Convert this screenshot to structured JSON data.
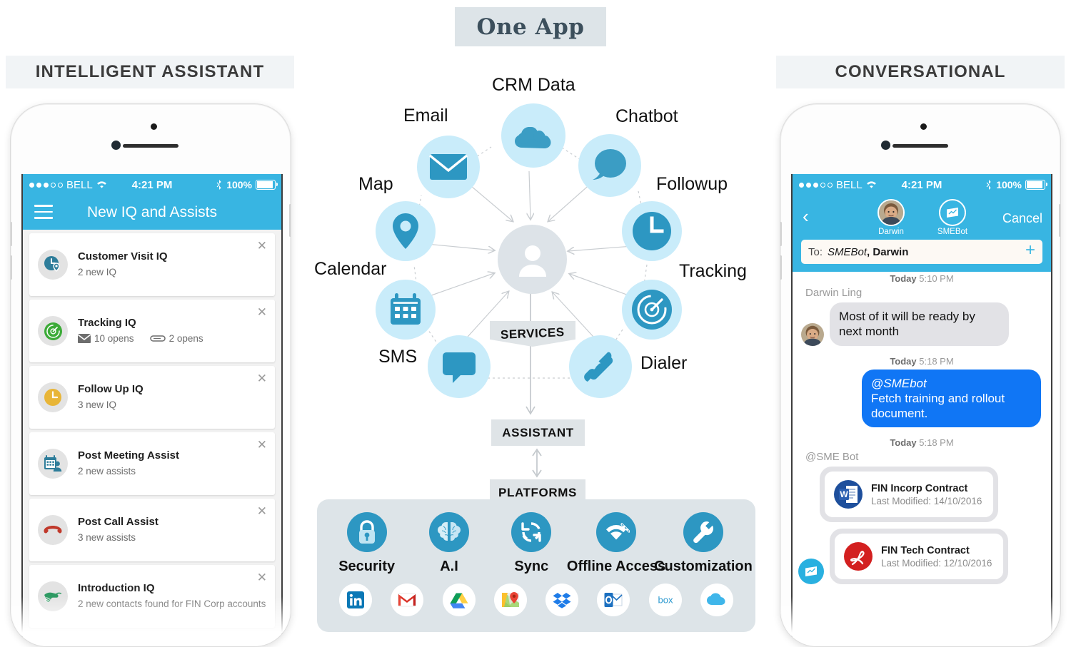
{
  "banner": {
    "title": "One App"
  },
  "columns": {
    "left_header": "INTELLIGENT ASSISTANT",
    "right_header": "CONVERSATIONAL"
  },
  "colors": {
    "ios_blue": "#38b5e2",
    "bubble_blue": "#1076f5",
    "node_fill": "#c9ecfa",
    "node_icon": "#2d97c2",
    "panel_gray": "#dde4e8",
    "banner_text": "#3c4f5c"
  },
  "left_phone": {
    "statusbar": {
      "carrier": "BELL",
      "time": "4:21 PM",
      "battery": "100%"
    },
    "nav": {
      "menu_icon": "hamburger-icon",
      "title": "New IQ and Assists"
    },
    "items": [
      {
        "title": "Customer Visit IQ",
        "subtitle": "2 new IQ",
        "icon": "clock-location-icon",
        "close": "✕"
      },
      {
        "title": "Tracking IQ",
        "meta": [
          {
            "icon": "envelope-icon",
            "text": "10 opens"
          },
          {
            "icon": "paperclip-icon",
            "text": "2 opens"
          }
        ],
        "icon": "speedometer-icon",
        "close": "✕"
      },
      {
        "title": "Follow Up IQ",
        "subtitle": "3 new IQ",
        "icon": "clock-icon",
        "close": "✕"
      },
      {
        "title": "Post Meeting Assist",
        "subtitle": "2 new assists",
        "icon": "calendar-person-icon",
        "close": "✕"
      },
      {
        "title": "Post Call Assist",
        "subtitle": "3 new assists",
        "icon": "phone-hangup-icon",
        "close": "✕"
      },
      {
        "title": "Introduction IQ",
        "subtitle": "2 new contacts found for FIN Corp accounts",
        "icon": "handshake-icon",
        "close": "✕"
      }
    ]
  },
  "right_phone": {
    "statusbar": {
      "carrier": "BELL",
      "time": "4:21 PM",
      "battery": "100%"
    },
    "nav": {
      "back": "‹",
      "cancel": "Cancel"
    },
    "participants": [
      {
        "name": "Darwin",
        "icon": "avatar-photo"
      },
      {
        "name": "SMEBot",
        "icon": "bot-icon"
      }
    ],
    "to_field": {
      "label": "To:",
      "recipient_italic": "SMEBot",
      "recipient_rest": ", Darwin",
      "add_icon": "plus-icon"
    },
    "messages": [
      {
        "type": "timestamp",
        "day": "Today",
        "time": "5:10 PM"
      },
      {
        "type": "sender",
        "name": "Darwin Ling"
      },
      {
        "type": "incoming",
        "text": "Most of it will be ready by next month"
      },
      {
        "type": "timestamp",
        "day": "Today",
        "time": "5:18 PM"
      },
      {
        "type": "outgoing",
        "mention": "@SMEbot",
        "text": "Fetch training and rollout document."
      },
      {
        "type": "timestamp",
        "day": "Today",
        "time": "5:18 PM"
      },
      {
        "type": "sender",
        "name": "@SME Bot"
      },
      {
        "type": "document",
        "icon": "word-icon",
        "title": "FIN Incorp Contract",
        "subtitle": "Last Modified: 14/10/2016"
      },
      {
        "type": "document",
        "icon": "pdf-icon",
        "title": "FIN Tech Contract",
        "subtitle": "Last Modified: 12/10/2016"
      }
    ]
  },
  "diagram": {
    "hub": {
      "icon": "user-icon"
    },
    "ribbon": "SERVICES",
    "assistant_box": "ASSISTANT",
    "platforms_box": "PLATFORMS",
    "nodes": [
      {
        "label": "CRM Data",
        "icon": "cloud-icon"
      },
      {
        "label": "Chatbot",
        "icon": "chat-bubble-icon"
      },
      {
        "label": "Followup",
        "icon": "clock-icon"
      },
      {
        "label": "Tracking",
        "icon": "speedometer-icon"
      },
      {
        "label": "Dialer",
        "icon": "phone-icon"
      },
      {
        "label": "SMS",
        "icon": "sms-icon"
      },
      {
        "label": "Calendar",
        "icon": "calendar-icon"
      },
      {
        "label": "Map",
        "icon": "map-pin-icon"
      },
      {
        "label": "Email",
        "icon": "envelope-icon"
      }
    ],
    "features": [
      {
        "label": "Security",
        "icon": "lock-icon"
      },
      {
        "label": "A.I",
        "icon": "brain-icon"
      },
      {
        "label": "Sync",
        "icon": "sync-icon"
      },
      {
        "label": "Offline Access",
        "icon": "wifi-off-icon"
      },
      {
        "label": "Customization",
        "icon": "wrench-icon"
      }
    ],
    "platform_logos": [
      {
        "name": "linkedin-logo"
      },
      {
        "name": "gmail-logo"
      },
      {
        "name": "google-drive-logo"
      },
      {
        "name": "google-maps-logo"
      },
      {
        "name": "dropbox-logo"
      },
      {
        "name": "outlook-logo"
      },
      {
        "name": "box-logo"
      },
      {
        "name": "icloud-logo"
      }
    ]
  }
}
